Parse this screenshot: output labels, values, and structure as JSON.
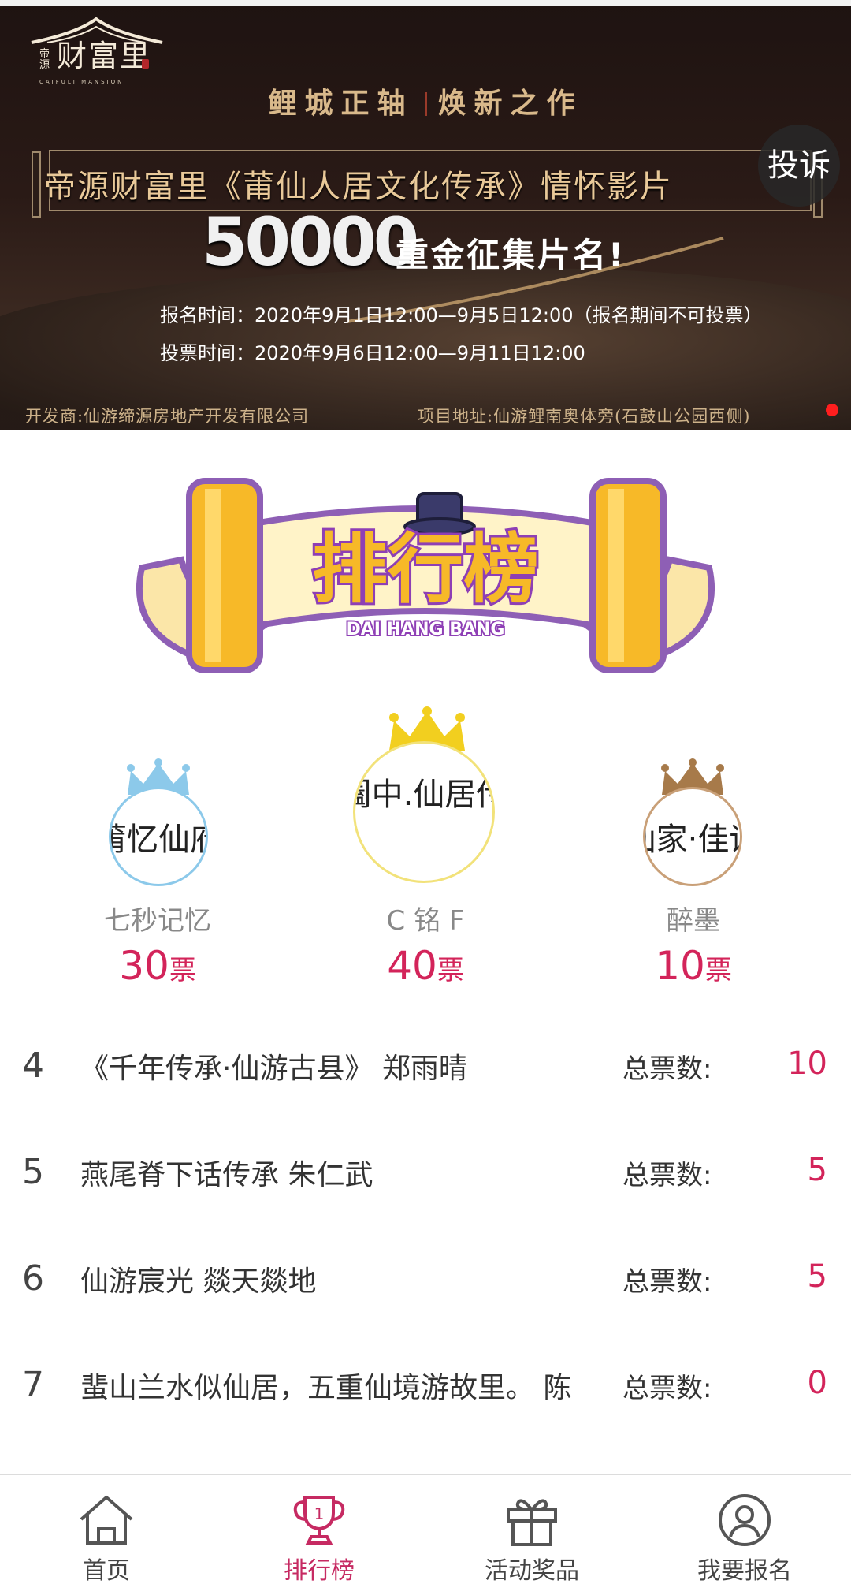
{
  "banner": {
    "logo_text": "财富里",
    "logo_small": "帝源",
    "logo_sub": "CAIFULI MANSION",
    "slogan_left": "鲤城正轴",
    "slogan_right": "焕新之作",
    "title": "帝源财富里《莆仙人居文化传承》情怀影片",
    "prize_amount": "50000",
    "prize_text": "重金征集片名!",
    "signup_time": "报名时间：2020年9月1日12:00—9月5日12:00（报名期间不可投票）",
    "vote_time": "投票时间：2020年9月6日12:00—9月11日12:00",
    "developer": "开发商:仙游缔源房地产开发有限公司",
    "address": "项目地址:仙游鲤南奥体旁(石鼓山公园西侧)",
    "complaint_label": "投诉"
  },
  "ranking_art": {
    "title": "排行榜",
    "subtitle": "DAI HANG BANG"
  },
  "podium": [
    {
      "avatar_text": "阖中.仙居传",
      "name": "C 铭 F",
      "votes": "40",
      "unit": "票",
      "crown": "gold"
    },
    {
      "avatar_text": "莆忆仙府",
      "name": "七秒记忆",
      "votes": "30",
      "unit": "票",
      "crown": "blue"
    },
    {
      "avatar_text": "仙家·佳话",
      "name": "醉墨",
      "votes": "10",
      "unit": "票",
      "crown": "bronze"
    }
  ],
  "list": [
    {
      "rank": "4",
      "title": "《千年传承·仙游古县》 郑雨晴",
      "label": "总票数:",
      "count": "10"
    },
    {
      "rank": "5",
      "title": "燕尾脊下话传承 朱仁武",
      "label": "总票数:",
      "count": "5"
    },
    {
      "rank": "6",
      "title": "仙游宸光 燚天燚地",
      "label": "总票数:",
      "count": "5"
    },
    {
      "rank": "7",
      "title": "蜚山兰水似仙居，五重仙境游故里。 陈",
      "label": "总票数:",
      "count": "0"
    }
  ],
  "tabs": [
    {
      "label": "首页",
      "icon": "home-icon",
      "active": false
    },
    {
      "label": "排行榜",
      "icon": "trophy-icon",
      "active": true
    },
    {
      "label": "活动奖品",
      "icon": "gift-icon",
      "active": false
    },
    {
      "label": "我要报名",
      "icon": "user-icon",
      "active": false
    }
  ],
  "colors": {
    "accent": "#d3245a",
    "tab_active": "#c62a62",
    "banner_gold": "#e9c999"
  }
}
